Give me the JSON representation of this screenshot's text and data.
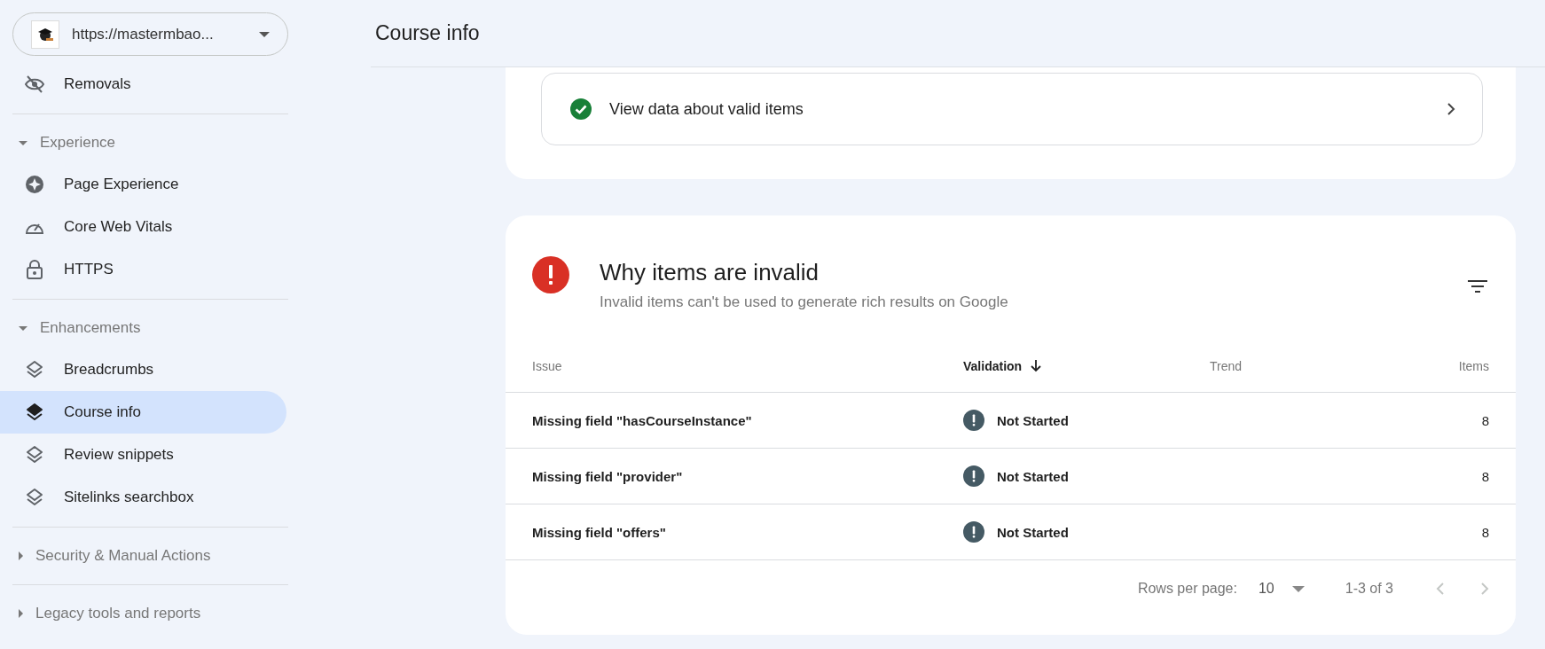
{
  "sidebar": {
    "site": {
      "url": "https://mastermbao..."
    },
    "groups": [
      {
        "items": [
          {
            "label": "Removals",
            "selected": false
          }
        ]
      },
      {
        "label": "Experience",
        "expanded": true,
        "items": [
          {
            "label": "Page Experience",
            "selected": false
          },
          {
            "label": "Core Web Vitals",
            "selected": false
          },
          {
            "label": "HTTPS",
            "selected": false
          }
        ]
      },
      {
        "label": "Enhancements",
        "expanded": true,
        "items": [
          {
            "label": "Breadcrumbs",
            "selected": false
          },
          {
            "label": "Course info",
            "selected": true
          },
          {
            "label": "Review snippets",
            "selected": false
          },
          {
            "label": "Sitelinks searchbox",
            "selected": false
          }
        ]
      },
      {
        "label": "Security & Manual Actions",
        "expanded": false
      },
      {
        "label": "Legacy tools and reports",
        "expanded": false
      }
    ]
  },
  "header": {
    "title": "Course info"
  },
  "valid_card": {
    "link": "View data about valid items"
  },
  "invalid_card": {
    "title": "Why items are invalid",
    "subtitle": "Invalid items can't be used to generate rich results on Google",
    "table": {
      "columns": [
        {
          "label": "Issue",
          "sorted": false
        },
        {
          "label": "Validation",
          "sorted": true
        },
        {
          "label": "Trend",
          "sorted": false
        },
        {
          "label": "Items",
          "sorted": false
        }
      ],
      "rows": [
        {
          "issue": "Missing field \"hasCourseInstance\"",
          "validation": "Not Started",
          "items": "8"
        },
        {
          "issue": "Missing field \"provider\"",
          "validation": "Not Started",
          "items": "8"
        },
        {
          "issue": "Missing field \"offers\"",
          "validation": "Not Started",
          "items": "8"
        }
      ]
    },
    "pagination": {
      "rows_label": "Rows per page:",
      "rows_value": "10",
      "range": "1-3 of 3",
      "prev_disabled": true,
      "next_disabled": true
    }
  }
}
